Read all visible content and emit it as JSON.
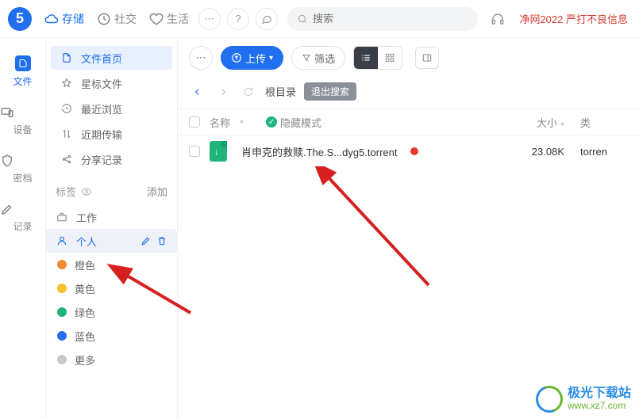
{
  "header": {
    "tabs": {
      "storage": "存储",
      "social": "社交",
      "life": "生活"
    },
    "search_placeholder": "搜索",
    "warning": "净网2022 严打不良信息"
  },
  "leftnav": {
    "files": "文件",
    "devices": "设备",
    "vault": "密档",
    "log": "记录"
  },
  "sidebar": {
    "items": [
      "文件首页",
      "星标文件",
      "最近浏览",
      "近期传输",
      "分享记录"
    ],
    "tags_label": "标签",
    "add_label": "添加",
    "tags": {
      "work": "工作",
      "personal": "个人",
      "orange": "橙色",
      "yellow": "黄色",
      "green": "绿色",
      "blue": "蓝色",
      "more": "更多"
    }
  },
  "toolbar": {
    "upload": "上传",
    "filter": "筛选"
  },
  "breadcrumb": {
    "root": "根目录",
    "exit_search": "退出搜索"
  },
  "table": {
    "headers": {
      "name": "名称",
      "hide_mode": "隐藏模式",
      "size": "大小",
      "type": "类"
    },
    "row": {
      "name": "肖申克的救赎.The.S...dyg5.torrent",
      "size": "23.08K",
      "type": "torren"
    }
  },
  "watermark": {
    "line1": "极光下载站",
    "line2": "www.xz7.com"
  }
}
